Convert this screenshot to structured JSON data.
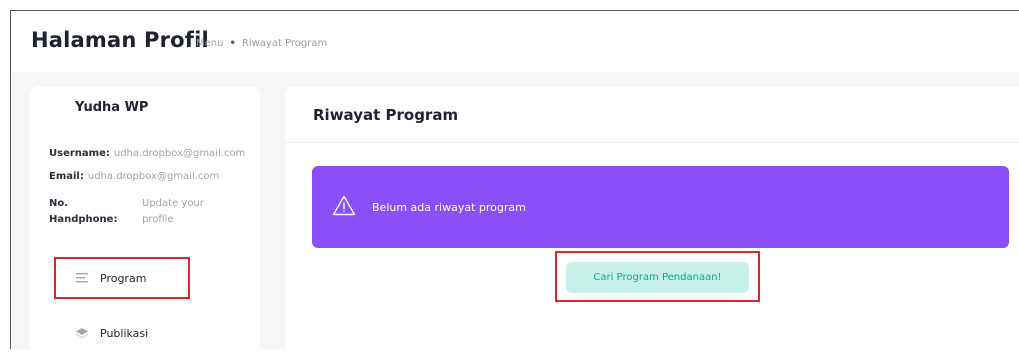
{
  "header": {
    "title": "Halaman Profil",
    "breadcrumb": {
      "first": "Menu",
      "separator": "•",
      "current": "Riwayat Program"
    }
  },
  "profile": {
    "name": "Yudha WP",
    "username_label": "Username:",
    "username_value": "udha.dropbox@gmail.com",
    "email_label": "Email:",
    "email_value": "udha.dropbox@gmail.com",
    "phone_label_line1": "No.",
    "phone_label_line2": "Handphone:",
    "phone_value_line1": "Update your",
    "phone_value_line2": "profile"
  },
  "nav": {
    "items": [
      {
        "label": "Program",
        "icon": "list-icon",
        "active": true
      },
      {
        "label": "Publikasi",
        "icon": "layers-icon",
        "active": false
      }
    ]
  },
  "main": {
    "title": "Riwayat Program",
    "alert": {
      "icon": "warning-icon",
      "text": "Belum ada riwayat program"
    },
    "cta_label": "Cari Program Pendanaan!"
  },
  "colors": {
    "alert_bg": "#8a4ff7",
    "cta_bg": "#c6f1e9",
    "cta_text": "#17a58b",
    "highlight_outline": "#d7282f"
  }
}
